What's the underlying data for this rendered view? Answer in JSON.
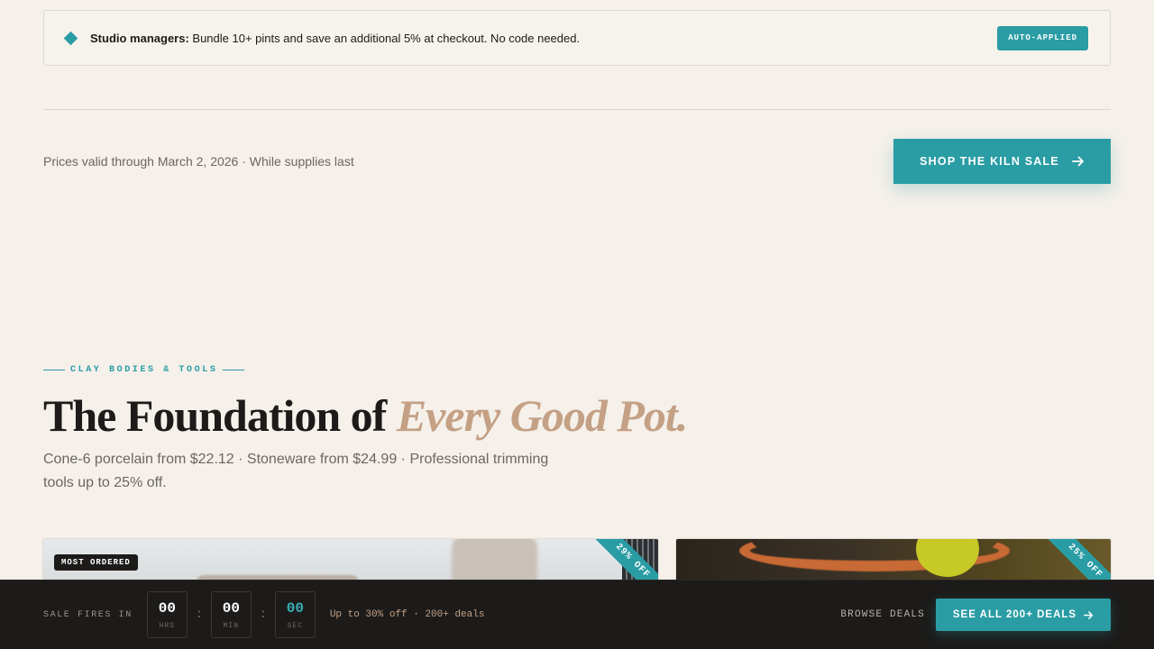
{
  "promo": {
    "strong": "Studio managers:",
    "text": " Bundle 10+ pints and save an additional 5% at checkout. No code needed.",
    "badge": "AUTO-APPLIED"
  },
  "sale_strip": {
    "validity": "Prices valid through March 2, 2026 · While supplies last",
    "cta_label": "SHOP THE KILN SALE"
  },
  "section": {
    "eyebrow": "CLAY BODIES & TOOLS",
    "headline_plain": "The Foundation of ",
    "headline_accent": "Every Good Pot.",
    "subtitle": "Cone-6 porcelain from $22.12 · Stoneware from $24.99 · Professional trimming tools up to 25% off."
  },
  "cards": [
    {
      "tag": "MOST ORDERED",
      "ribbon": "29% OFF"
    },
    {
      "tag": "",
      "ribbon": "25% OFF"
    }
  ],
  "countdown_bar": {
    "label": "SALE FIRES IN",
    "hours": "00",
    "hours_unit": "HRS",
    "minutes": "00",
    "minutes_unit": "MIN",
    "seconds": "00",
    "seconds_unit": "SEC",
    "separator": ":",
    "deal_text": "Up to 30% off · 200+ deals",
    "browse_label": "BROWSE DEALS",
    "cta_label": "SEE ALL 200+ DEALS"
  },
  "colors": {
    "accent": "#2a9ca4",
    "accent_warm": "#c4a084",
    "background": "#f5f0ea",
    "dark_bar": "#1c1b1a"
  },
  "icons": {
    "promo_marker": "diamond-icon",
    "cta_arrow": "arrow-right-icon"
  }
}
